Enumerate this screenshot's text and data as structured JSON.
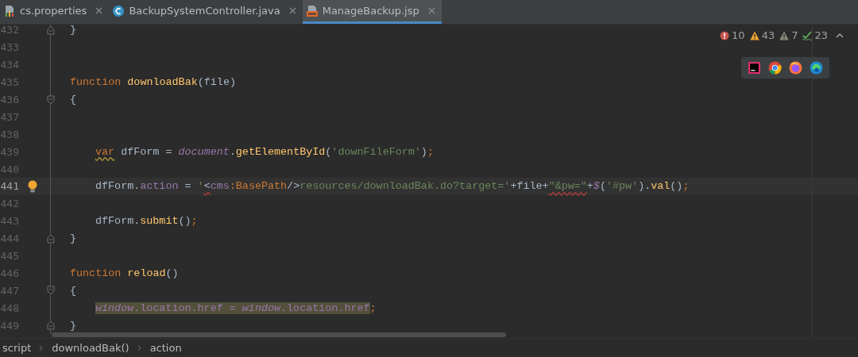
{
  "tabs": [
    {
      "label": "cs.properties",
      "kind": "properties",
      "selected": false
    },
    {
      "label": "BackupSystemController.java",
      "kind": "class",
      "selected": false
    },
    {
      "label": "ManageBackup.jsp",
      "kind": "jsp",
      "selected": true
    }
  ],
  "inspections": [
    {
      "kind": "error",
      "count": "10"
    },
    {
      "kind": "warning",
      "count": "43"
    },
    {
      "kind": "weak",
      "count": "7"
    },
    {
      "kind": "typo",
      "count": "23"
    }
  ],
  "lines": [
    {
      "number": "432",
      "current": false,
      "fold_end": true,
      "tokens": [
        {
          "text": "}",
          "kind": "plain"
        }
      ]
    },
    {
      "number": "433",
      "current": false
    },
    {
      "number": "434",
      "current": false
    },
    {
      "number": "435",
      "current": false,
      "tokens": [
        {
          "text": "function ",
          "kind": "keyword"
        },
        {
          "text": "downloadBak",
          "kind": "fn"
        },
        {
          "text": "(file)",
          "kind": "plain"
        }
      ]
    },
    {
      "number": "436",
      "current": false,
      "fold_start": true,
      "tokens": [
        {
          "text": "{",
          "kind": "plain"
        }
      ]
    },
    {
      "number": "437",
      "current": false
    },
    {
      "number": "438",
      "current": false
    },
    {
      "number": "439",
      "current": false,
      "indented": true,
      "tokens": [
        {
          "text": "var",
          "kind": "keyword",
          "warning": true
        },
        {
          "text": " dfForm = ",
          "kind": "plain"
        },
        {
          "text": "document",
          "kind": "global"
        },
        {
          "text": ".",
          "kind": "plain"
        },
        {
          "text": "getElementById",
          "kind": "fn"
        },
        {
          "text": "(",
          "kind": "plain"
        },
        {
          "text": "'downFileForm'",
          "kind": "string"
        },
        {
          "text": ")",
          "kind": "plain"
        },
        {
          "text": ";",
          "kind": "keyword"
        }
      ]
    },
    {
      "number": "440",
      "current": false
    },
    {
      "number": "441",
      "current": true,
      "intention": true,
      "indented": true,
      "tokens": [
        {
          "text": "dfForm.",
          "kind": "plain"
        },
        {
          "text": "action",
          "kind": "prop"
        },
        {
          "text": " = ",
          "kind": "plain"
        },
        {
          "text": "'",
          "kind": "string"
        },
        {
          "text": "<",
          "kind": "plain",
          "error": true
        },
        {
          "text": "cms",
          "kind": "prop"
        },
        {
          "text": ":BasePath",
          "kind": "keyword"
        },
        {
          "text": "/>",
          "kind": "plain"
        },
        {
          "text": "resources/downloadBak.do?target='",
          "kind": "string"
        },
        {
          "text": "+file+",
          "kind": "plain"
        },
        {
          "text": "\"&pw=\"",
          "kind": "string",
          "error": true
        },
        {
          "text": "+",
          "kind": "plain"
        },
        {
          "text": "$",
          "kind": "global"
        },
        {
          "text": "(",
          "kind": "plain"
        },
        {
          "text": "'#pw'",
          "kind": "string"
        },
        {
          "text": ").",
          "kind": "plain"
        },
        {
          "text": "val",
          "kind": "fn"
        },
        {
          "text": "()",
          "kind": "plain"
        },
        {
          "text": ";",
          "kind": "keyword"
        }
      ]
    },
    {
      "number": "442",
      "current": false
    },
    {
      "number": "443",
      "current": false,
      "indented": true,
      "tokens": [
        {
          "text": "dfForm.",
          "kind": "plain"
        },
        {
          "text": "submit",
          "kind": "fn"
        },
        {
          "text": "()",
          "kind": "plain"
        },
        {
          "text": ";",
          "kind": "keyword"
        }
      ]
    },
    {
      "number": "444",
      "current": false,
      "fold_end": true,
      "tokens": [
        {
          "text": "}",
          "kind": "plain"
        }
      ]
    },
    {
      "number": "445",
      "current": false
    },
    {
      "number": "446",
      "current": false,
      "tokens": [
        {
          "text": "function ",
          "kind": "keyword"
        },
        {
          "text": "reload",
          "kind": "fn"
        },
        {
          "text": "()",
          "kind": "plain"
        }
      ]
    },
    {
      "number": "447",
      "current": false,
      "fold_start": true,
      "tokens": [
        {
          "text": "{",
          "kind": "plain"
        }
      ]
    },
    {
      "number": "448",
      "current": false,
      "indented": true,
      "tokens": [
        {
          "text": "window",
          "kind": "global",
          "marked": true
        },
        {
          "text": ".location.href = ",
          "kind": "field",
          "marked": true
        },
        {
          "text": "window",
          "kind": "global",
          "marked": true
        },
        {
          "text": ".location.href",
          "kind": "field",
          "marked": true
        },
        {
          "text": ";",
          "kind": "keyword"
        }
      ]
    },
    {
      "number": "449",
      "current": false,
      "fold_end": true,
      "tokens": [
        {
          "text": "}",
          "kind": "plain"
        }
      ]
    }
  ],
  "breadcrumbs": [
    "script",
    "downloadBak()",
    "action"
  ]
}
